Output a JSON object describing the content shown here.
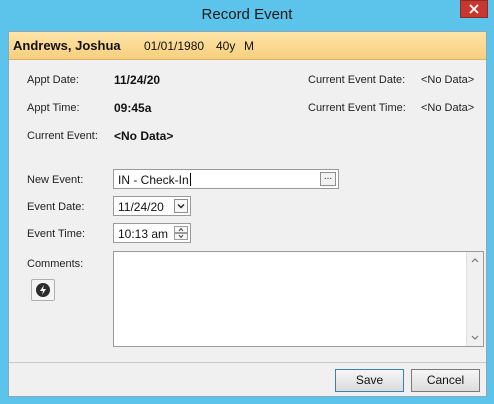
{
  "window": {
    "title": "Record Event",
    "close_icon": "close-icon"
  },
  "patient": {
    "name": "Andrews, Joshua",
    "dob": "01/01/1980",
    "age": "40y",
    "sex": "M"
  },
  "appt": {
    "date_label": "Appt Date:",
    "date_value": "11/24/20",
    "time_label": "Appt Time:",
    "time_value": "09:45a"
  },
  "current": {
    "event_label": "Current Event:",
    "event_value": "<No Data>",
    "event_date_label": "Current Event Date:",
    "event_date_value": "<No Data>",
    "event_time_label": "Current Event Time:",
    "event_time_value": "<No Data>"
  },
  "form": {
    "new_event_label": "New Event:",
    "new_event_value": "IN - Check-In",
    "ellipsis": "...",
    "event_date_label": "Event Date:",
    "event_date_value": "11/24/20",
    "event_time_label": "Event Time:",
    "event_time_value": "10:13 am",
    "comments_label": "Comments:",
    "comments_value": ""
  },
  "buttons": {
    "save": "Save",
    "cancel": "Cancel"
  },
  "colors": {
    "title_bar": "#5cc3ea",
    "banner_top": "#fde4a8",
    "banner_bottom": "#f7cf7e",
    "close_button": "#c7372f"
  }
}
